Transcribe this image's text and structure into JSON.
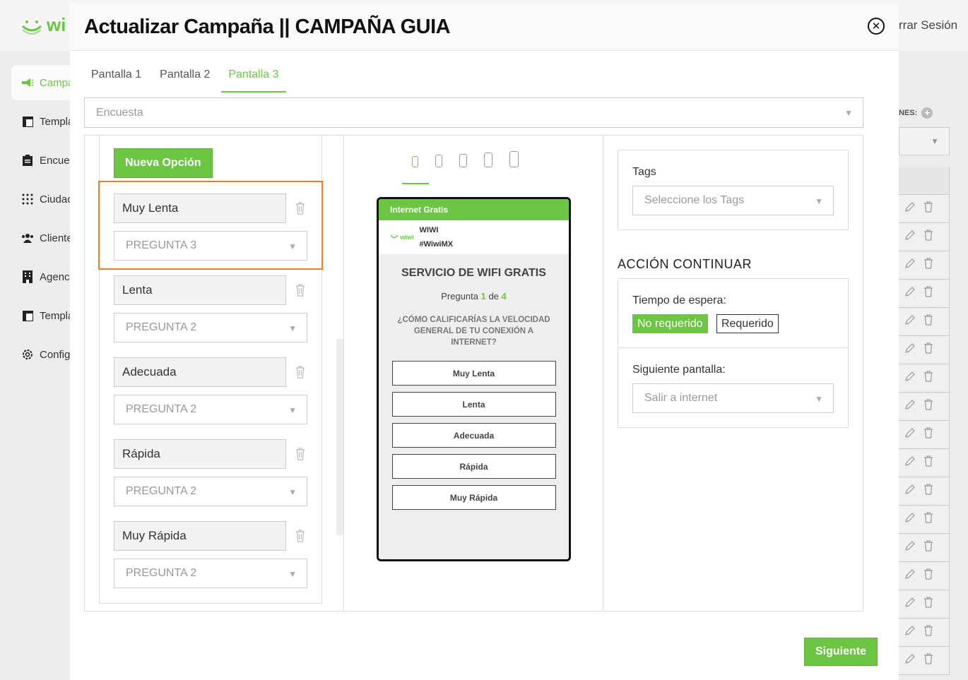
{
  "background": {
    "logo_text": "wi",
    "logout_label": "rrar Sesión",
    "nav": [
      {
        "label": "Campa",
        "icon": "megaphone-icon",
        "active": true
      },
      {
        "label": "Templa",
        "icon": "template-icon",
        "active": false
      },
      {
        "label": "Encue",
        "icon": "clipboard-icon",
        "active": false
      },
      {
        "label": "Ciudac",
        "icon": "grid-dots-icon",
        "active": false
      },
      {
        "label": "Cliente",
        "icon": "users-icon",
        "active": false
      },
      {
        "label": "Agenc",
        "icon": "building-icon",
        "active": false
      },
      {
        "label": "Templa",
        "icon": "template-icon",
        "active": false
      },
      {
        "label": "Config",
        "icon": "gear-icon",
        "active": false
      }
    ],
    "right_label": "NES:"
  },
  "modal": {
    "title": "Actualizar Campaña || CAMPAÑA GUIA",
    "tabs": [
      {
        "label": "Pantalla 1",
        "active": false
      },
      {
        "label": "Pantalla 2",
        "active": false
      },
      {
        "label": "Pantalla 3",
        "active": true
      }
    ],
    "type_select": "Encuesta",
    "new_option_label": "Nueva Opción",
    "options": [
      {
        "label": "Muy Lenta",
        "next": "PREGUNTA 3"
      },
      {
        "label": "Lenta",
        "next": "PREGUNTA 2"
      },
      {
        "label": "Adecuada",
        "next": "PREGUNTA 2"
      },
      {
        "label": "Rápida",
        "next": "PREGUNTA 2"
      },
      {
        "label": "Muy Rápida",
        "next": "PREGUNTA 2"
      }
    ],
    "preview": {
      "bar_title": "Internet Gratis",
      "logo_text": "wiwi",
      "brand_name": "WIWI",
      "brand_tag": "#WiwiMX",
      "title": "SERVICIO DE WIFI GRATIS",
      "question_prefix": "Pregunta",
      "question_current": "1",
      "question_of": "de",
      "question_total": "4",
      "question": "¿CÓMO CALIFICARÍAS LA VELOCIDAD GENERAL DE TU CONEXIÓN A INTERNET?",
      "options": [
        "Muy Lenta",
        "Lenta",
        "Adecuada",
        "Rápida",
        "Muy Rápida"
      ]
    },
    "tags_label": "Tags",
    "tags_placeholder": "Seleccione los Tags",
    "accion_heading": "ACCIÓN CONTINUAR",
    "wait_label": "Tiempo de espera:",
    "wait_options": [
      "No requerido",
      "Requerido"
    ],
    "next_screen_label": "Siguiente pantalla:",
    "next_screen_value": "Salir a internet",
    "next_button": "Siguiente"
  },
  "colors": {
    "accent": "#6cc644",
    "highlight": "#f47b20"
  }
}
